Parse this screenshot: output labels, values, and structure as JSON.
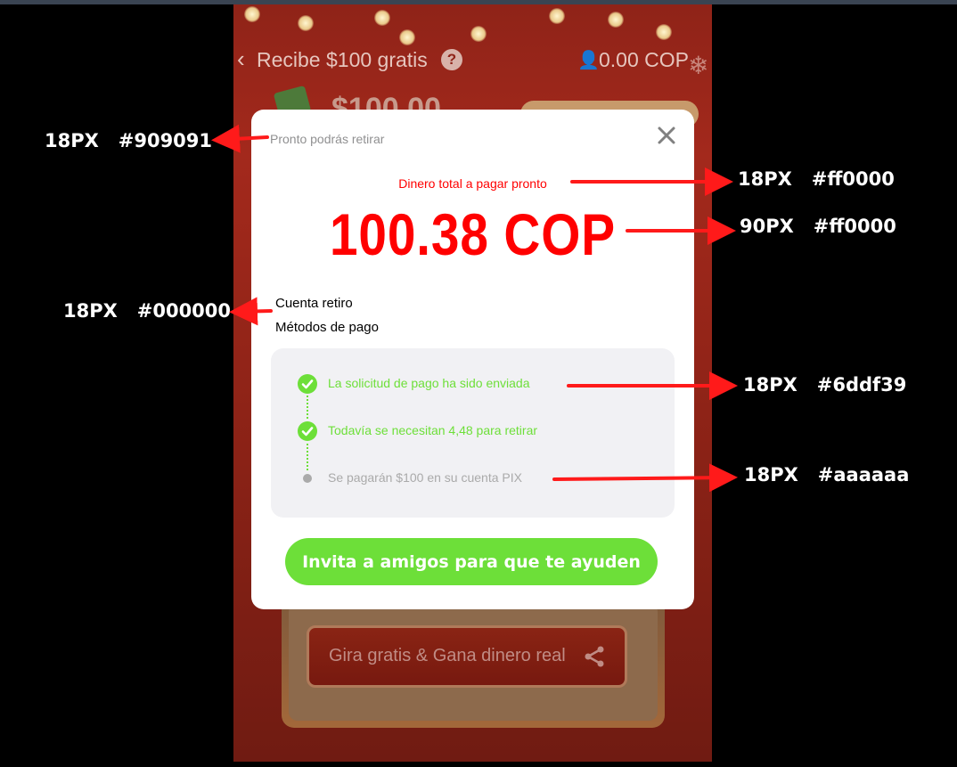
{
  "colors": {
    "hint": "#909091",
    "red": "#ff0000",
    "black": "#000000",
    "green": "#6ddf39",
    "gray": "#aaaaaa",
    "arrow": "#ff1a1a"
  },
  "background_app": {
    "title": "Recibe $100 gratis",
    "balance": "0.00  COP",
    "amount_partial": "$100.00",
    "spin_label": "Gira gratis & Gana dinero real",
    "icons": [
      "back-chevron-icon",
      "help-icon",
      "user-icon",
      "snowflake-icon",
      "share-icon"
    ]
  },
  "modal": {
    "hint": "Pronto podrás retirar",
    "total_label": "Dinero total a pagar pronto",
    "amount": "100.38 COP",
    "account_label": "Cuenta retiro",
    "method_label": "Métodos de pago",
    "steps": [
      {
        "text": "La solicitud de pago ha sido enviada",
        "status": "done"
      },
      {
        "text": "Todavía se necesitan 4,48 para retirar",
        "status": "done"
      },
      {
        "text": "Se pagarán $100 en su cuenta PIX",
        "status": "pending"
      }
    ],
    "invite_label": "Invita a amigos para que te ayuden"
  },
  "annotations": [
    {
      "size": "18PX",
      "color": "#909091"
    },
    {
      "size": "18PX",
      "color": "#ff0000"
    },
    {
      "size": "90PX",
      "color": "#ff0000"
    },
    {
      "size": "18PX",
      "color": "#000000"
    },
    {
      "size": "18PX",
      "color": "#6ddf39"
    },
    {
      "size": "18PX",
      "color": "#aaaaaa"
    }
  ]
}
